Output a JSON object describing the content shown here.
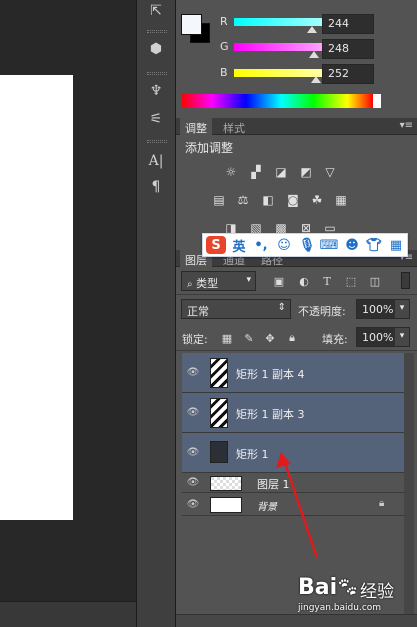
{
  "color": {
    "channels": [
      {
        "label": "R",
        "value": "244"
      },
      {
        "label": "G",
        "value": "248"
      },
      {
        "label": "B",
        "value": "252"
      }
    ],
    "foreground": "#f4f8fc",
    "background": "#000000"
  },
  "adjust_panel": {
    "tabs": [
      "调整",
      "样式"
    ],
    "heading": "添加调整"
  },
  "layers_panel": {
    "tabs": [
      "图层",
      "通道",
      "路径"
    ],
    "filter_kind": "类型",
    "blend_mode": "正常",
    "opacity_label": "不透明度:",
    "opacity_value": "100%",
    "lock_label": "锁定:",
    "fill_label": "填充:",
    "fill_value": "100%",
    "layers": [
      {
        "name": "矩形 1 副本 4",
        "selected": true
      },
      {
        "name": "矩形 1 副本 3",
        "selected": true
      },
      {
        "name": "矩形 1",
        "selected": true
      },
      {
        "name": "图层 1",
        "selected": false
      },
      {
        "name": "背景",
        "selected": false
      }
    ]
  },
  "ime": {
    "mode_label": "英"
  },
  "watermark": {
    "brand": "Bai",
    "brand2": "经验",
    "url": "jingyan.baidu.com"
  },
  "colors": {
    "arrow": "#e01b1b",
    "selection": "#55637a"
  }
}
